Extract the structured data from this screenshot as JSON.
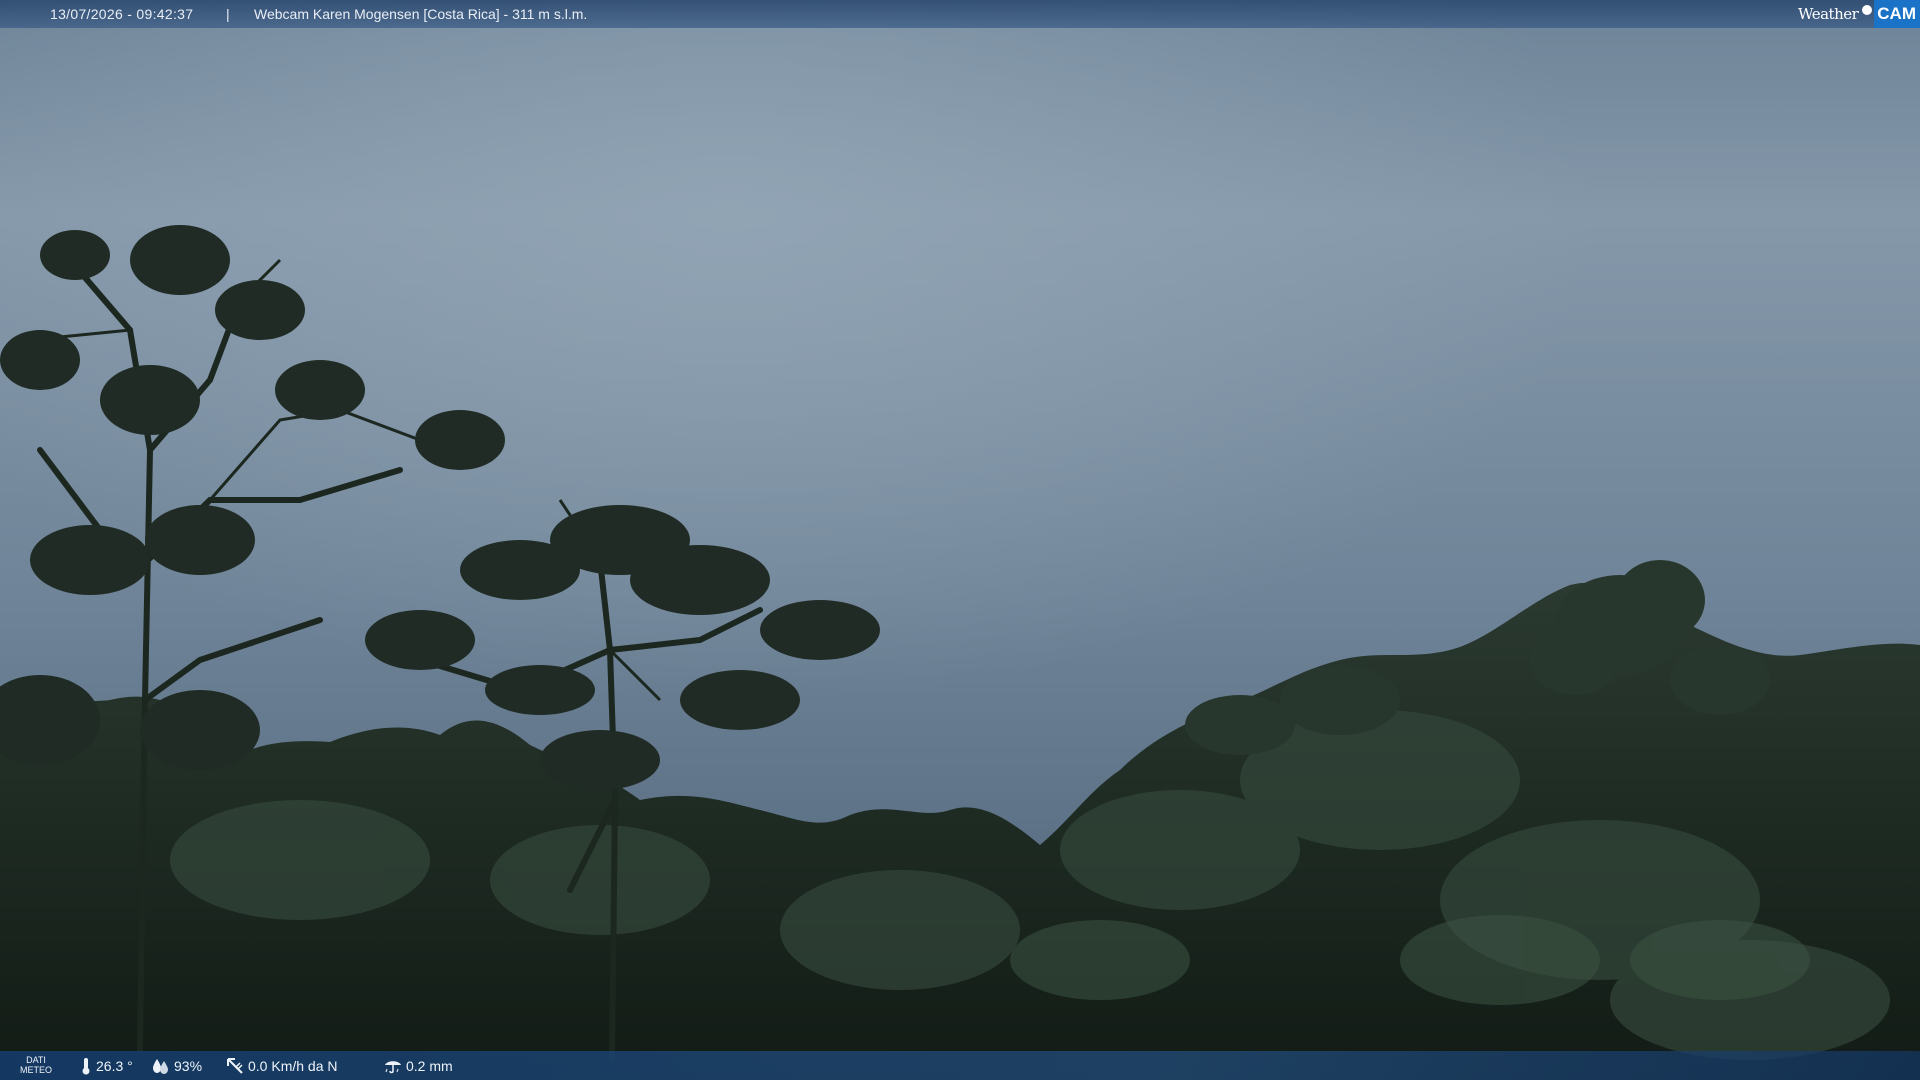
{
  "header": {
    "timestamp": "13/07/2026 - 09:42:37",
    "separator": "|",
    "title": "Webcam Karen Mogensen [Costa Rica] - 311 m s.l.m."
  },
  "logo": {
    "weather": "Weather",
    "cam": "CAM",
    "accent_color": "#1a73c6"
  },
  "meteo": {
    "label_line1": "DATI",
    "label_line2": "METEO",
    "temperature": "26.3 °",
    "humidity": "93%",
    "wind": "0.0 Km/h da N",
    "rain": "0.2 mm",
    "icons": [
      "thermometer-icon",
      "humidity-icon",
      "wind-icon",
      "rain-icon"
    ]
  },
  "colors": {
    "sky": "#7b90a2",
    "foliage": "#1f2c24",
    "bar": "#23507f"
  }
}
